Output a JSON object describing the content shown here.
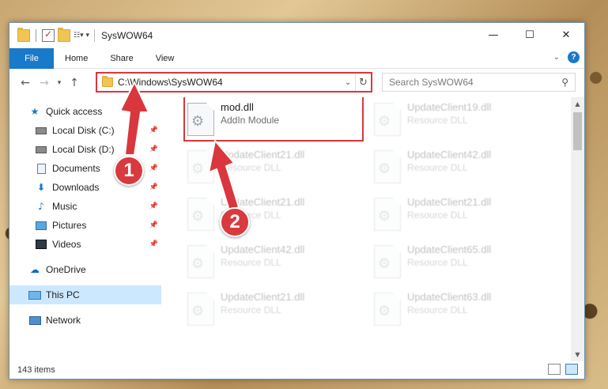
{
  "window": {
    "title": "SysWOW64",
    "controls": {
      "minimize": "—",
      "maximize": "☐",
      "close": "✕"
    }
  },
  "ribbon": {
    "tabs": [
      "File",
      "Home",
      "Share",
      "View"
    ],
    "help": "?"
  },
  "address": {
    "path": "C:\\Windows\\SysWOW64",
    "search_placeholder": "Search SysWOW64"
  },
  "sidebar": {
    "items": [
      {
        "label": "Quick access",
        "icon": "star-icon"
      },
      {
        "label": "Local Disk (C:)",
        "icon": "drive-icon",
        "pinned": true
      },
      {
        "label": "Local Disk (D:)",
        "icon": "drive-icon",
        "pinned": true
      },
      {
        "label": "Documents",
        "icon": "documents-icon",
        "pinned": true
      },
      {
        "label": "Downloads",
        "icon": "download-icon",
        "pinned": true
      },
      {
        "label": "Music",
        "icon": "music-icon",
        "pinned": true
      },
      {
        "label": "Pictures",
        "icon": "pictures-icon",
        "pinned": true
      },
      {
        "label": "Videos",
        "icon": "videos-icon",
        "pinned": true
      },
      {
        "label": "OneDrive",
        "icon": "cloud-icon"
      },
      {
        "label": "This PC",
        "icon": "computer-icon",
        "selected": true
      },
      {
        "label": "Network",
        "icon": "network-icon"
      }
    ]
  },
  "files": [
    {
      "name": "mod.dll",
      "type": "AddIn Module",
      "highlighted": true
    },
    {
      "name": "UpdateClient19.dll",
      "type": "Resource DLL"
    },
    {
      "name": "UpdateClient21.dll",
      "type": "Resource DLL"
    },
    {
      "name": "UpdateClient42.dll",
      "type": "Resource DLL"
    },
    {
      "name": "UpdateClient21.dll",
      "type": "Resource DLL"
    },
    {
      "name": "UpdateClient21.dll",
      "type": "Resource DLL"
    },
    {
      "name": "UpdateClient42.dll",
      "type": "Resource DLL"
    },
    {
      "name": "UpdateClient65.dll",
      "type": "Resource DLL"
    },
    {
      "name": "UpdateClient21.dll",
      "type": "Resource DLL"
    },
    {
      "name": "UpdateClient63.dll",
      "type": "Resource DLL"
    }
  ],
  "status": {
    "count": "143 items"
  },
  "annotations": {
    "step1": "1",
    "step2": "2",
    "color": "#d9373d"
  }
}
